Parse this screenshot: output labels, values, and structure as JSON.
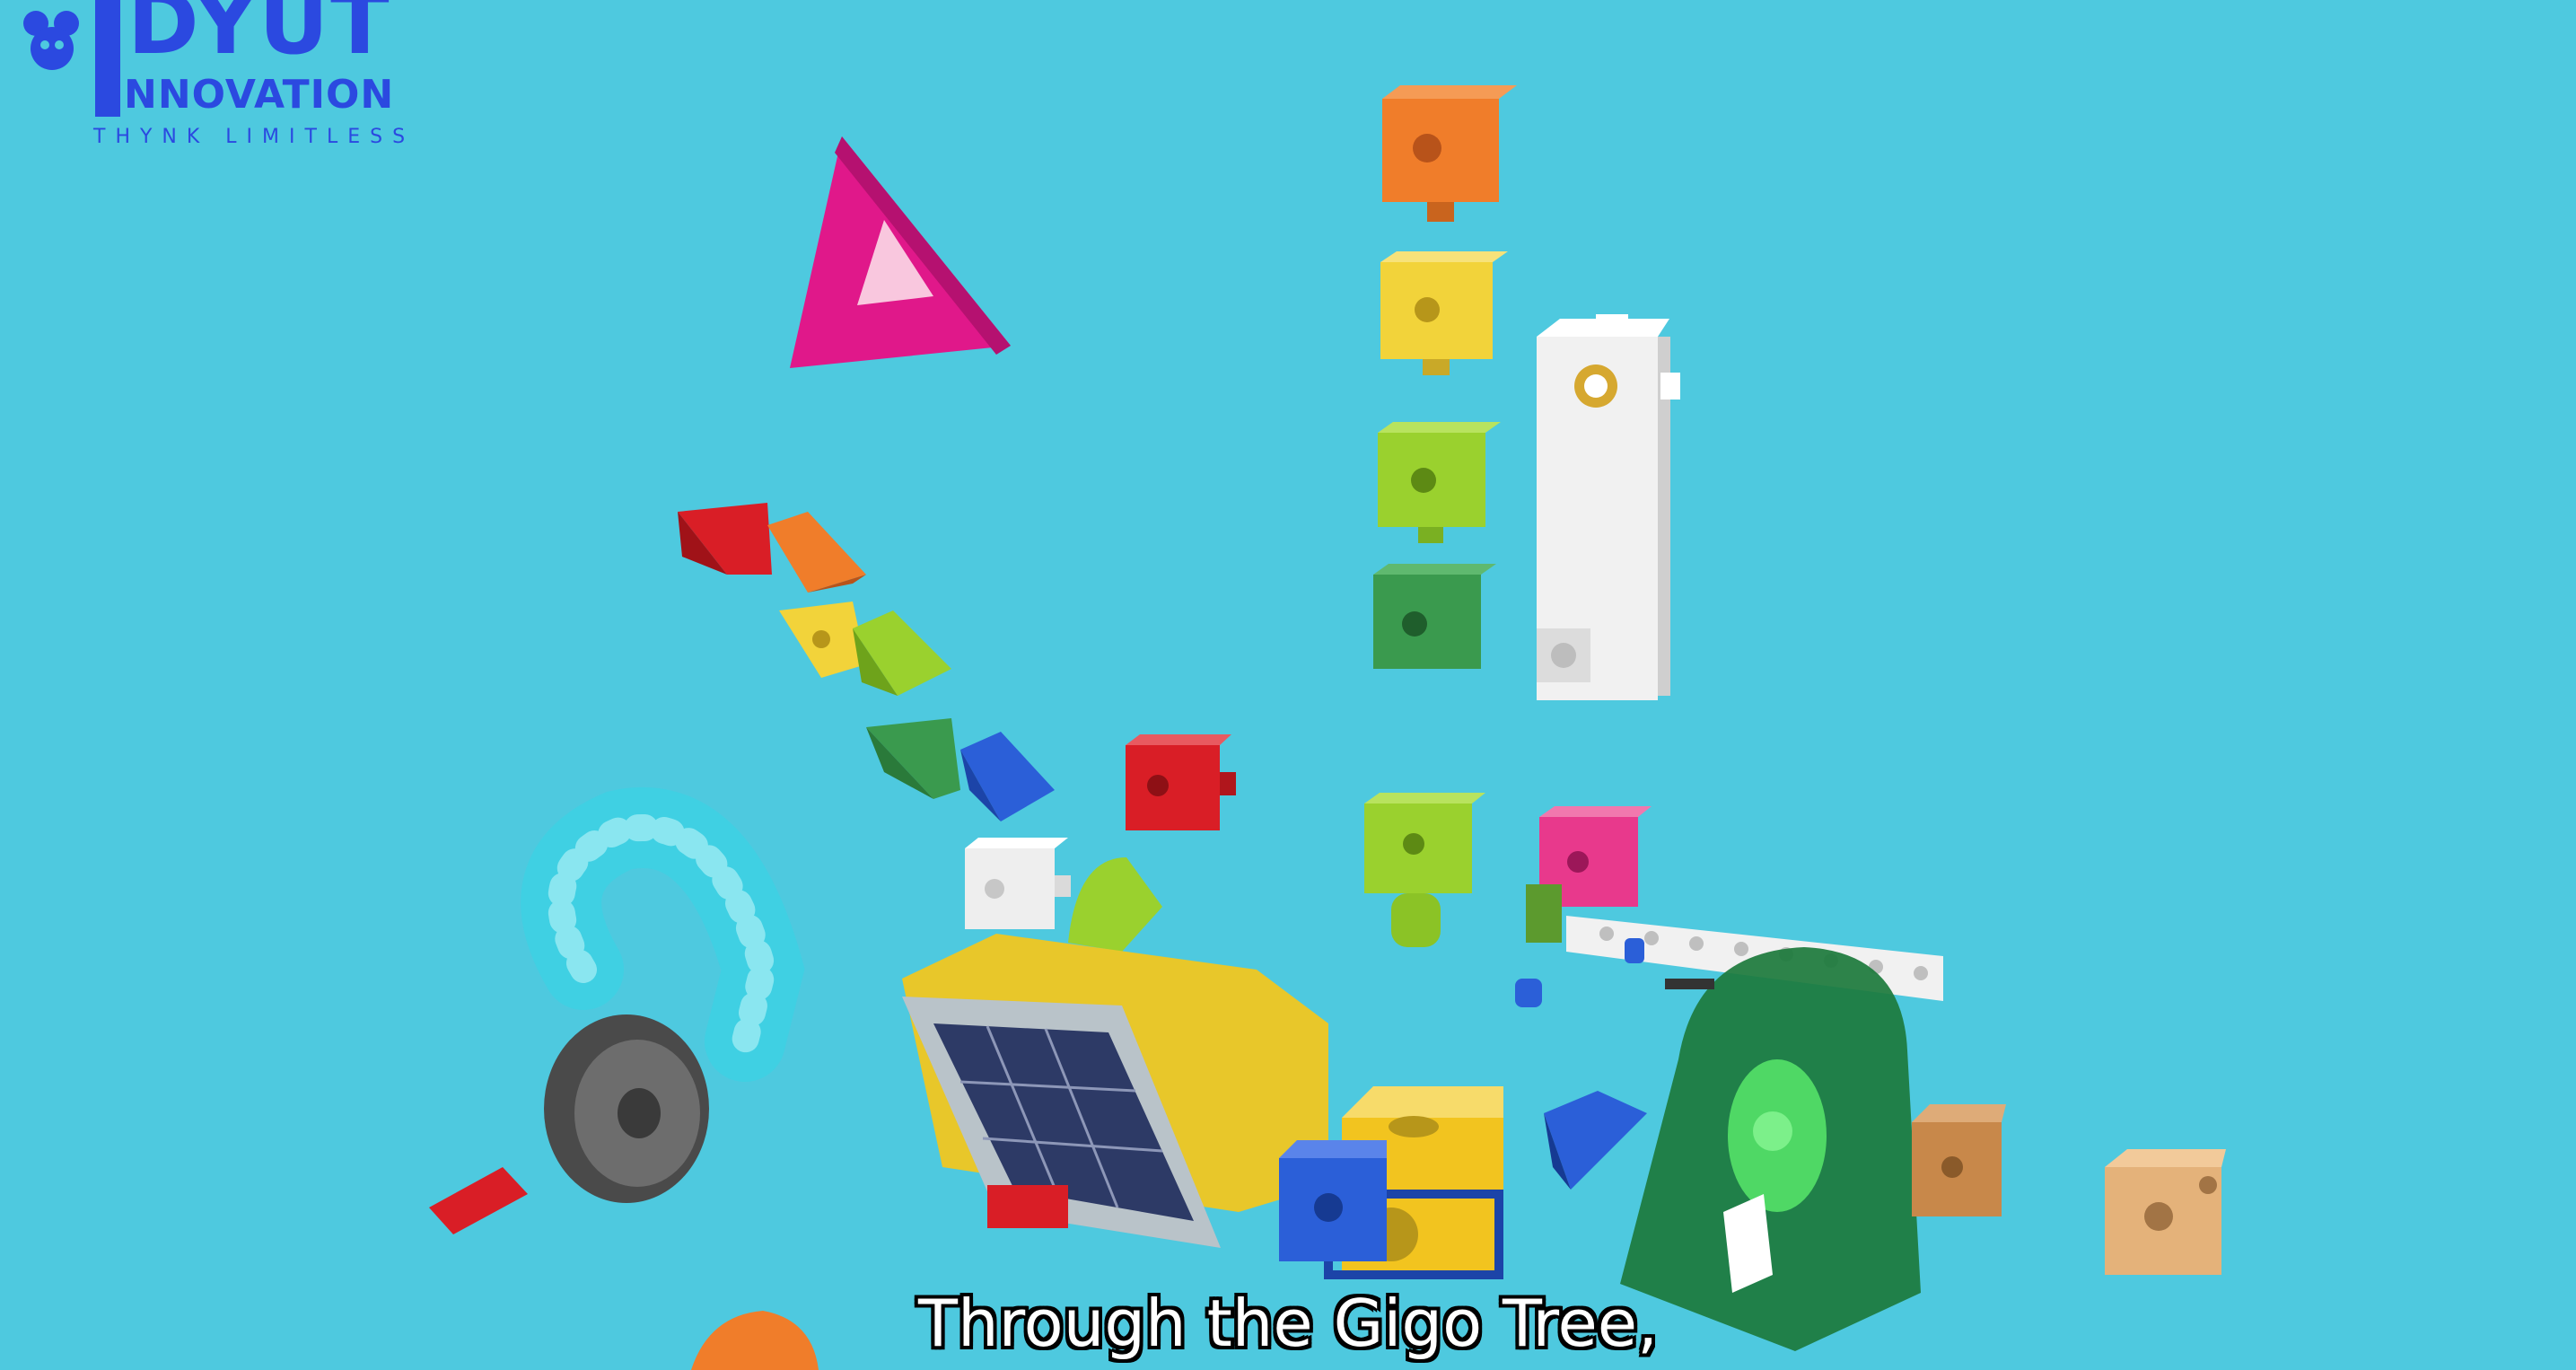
{
  "logo": {
    "line1": "DYUT",
    "line2": "NNOVATION",
    "tagline": "THYNK LIMITLESS",
    "color": "#2b49e0"
  },
  "subtitle": "Through the Gigo Tree,",
  "scene": {
    "background": "#4ec9df",
    "pieces": [
      "magenta-triangle-frame",
      "orange-cube",
      "yellow-cube",
      "lime-cube",
      "green-cube",
      "white-long-beam",
      "red-wedge",
      "orange-wedge",
      "yellow-cube-small",
      "lime-wedge",
      "green-wedge",
      "blue-wedge",
      "red-cube",
      "white-cube",
      "lime-quarter-round",
      "lime-cube-with-peg",
      "pink-cube",
      "white-beam-with-holes",
      "cyan-flexible-tube",
      "gray-wheel",
      "red-peg",
      "solar-panel-base",
      "yellow-cube-large",
      "blue-cube",
      "blue-wedge-small",
      "green-transparent-motor-housing",
      "tan-cube-left",
      "tan-cube-right",
      "orange-piece-bottom"
    ]
  }
}
